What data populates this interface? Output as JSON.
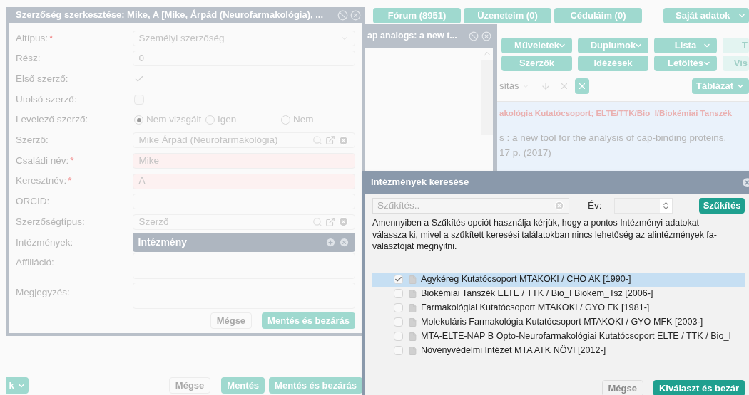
{
  "background_page": {
    "top_nav": [
      {
        "label": "Fórum (8951)",
        "dropdown": false
      },
      {
        "label": "Üzeneteim (0)",
        "dropdown": false
      },
      {
        "label": "Céduláim (0)",
        "dropdown": false
      },
      {
        "label": "Saját adatok",
        "dropdown": true
      }
    ],
    "toolbar_rows": [
      [
        {
          "label": "Műveletek",
          "dropdown": true,
          "disabled": false
        },
        {
          "label": "Duplumok",
          "dropdown": true,
          "disabled": false
        },
        {
          "label": "Lista",
          "dropdown": true,
          "disabled": false
        },
        {
          "label": "T",
          "dropdown": false,
          "disabled": true
        }
      ],
      [
        {
          "label": "Szerzők",
          "dropdown": false,
          "disabled": false
        },
        {
          "label": "Idézések",
          "dropdown": false,
          "disabled": false
        },
        {
          "label": "Letöltés",
          "dropdown": true,
          "disabled": false
        },
        {
          "label": "Vis",
          "dropdown": false,
          "disabled": true
        }
      ]
    ],
    "filter_bar": {
      "sort_select": "sítás",
      "view_button": "Táblázat"
    },
    "record": {
      "institutions": "akológia Kutatócsoport; ELTE/TTK/Bio_I/Biokémiai Tanszék",
      "title": "s : a new tool for the analysis of cap-binding proteins.",
      "source": "17 p. (2017)"
    }
  },
  "background_window": {
    "title": "ap analogs: a new t..."
  },
  "author_dialog": {
    "title": "Szerzőség szerkesztése: Mike, A [Mike, Árpád (Neurofarmakológia), ...",
    "fields": [
      {
        "label": "Altípus:",
        "required_mark": "*",
        "kind": "select",
        "value": "Személyi szerzőség"
      },
      {
        "label": "Rész:",
        "kind": "text",
        "value": "0"
      },
      {
        "label": "Első szerző:",
        "kind": "checkbox",
        "checked": true
      },
      {
        "label": "Utolsó szerző:",
        "kind": "checkbox",
        "checked": false
      },
      {
        "label": "Levelező szerző:",
        "kind": "radio",
        "options": [
          {
            "label": "Nem vizsgált",
            "selected": true
          },
          {
            "label": "Igen",
            "selected": false
          },
          {
            "label": "Nem",
            "selected": false
          }
        ]
      },
      {
        "label": "Szerző:",
        "kind": "lookup",
        "value": "Mike Árpád (Neurofarmakológia)"
      },
      {
        "label": "Családi név:",
        "required_mark": "*",
        "kind": "text",
        "value": "Mike"
      },
      {
        "label": "Keresztnév:",
        "required_mark": "*",
        "kind": "text",
        "value": "A"
      },
      {
        "label": "ORCID:",
        "kind": "text"
      },
      {
        "label": "Szerzőségtípus:",
        "kind": "lookup",
        "value": "Szerző"
      },
      {
        "label": "Intézmények:",
        "kind": "list",
        "value": "Intézmény"
      },
      {
        "label": "Affiliáció:",
        "kind": "textarea"
      },
      {
        "label": "Megjegyzés:",
        "kind": "textarea"
      }
    ],
    "buttons": [
      {
        "label": "Mégse",
        "primary": false
      },
      {
        "label": "Mentés és bezárás",
        "primary": true
      }
    ]
  },
  "outer_footer": {
    "menu_button": "k",
    "buttons": [
      {
        "label": "Mégse",
        "primary": false
      },
      {
        "label": "Mentés",
        "primary": true
      },
      {
        "label": "Mentés és bezárás",
        "primary": true
      }
    ]
  },
  "institution_dialog": {
    "title": "Intézmények keresése",
    "filter_placeholder": "Szűkítés..",
    "year_label": "Év:",
    "filter_button": "Szűkítés",
    "notice": "Amennyiben a Szűkítés opciót használja kérjük, hogy a pontos Intézményi adatokat válassza ki, mivel a szűkített keresési találatokban nincs lehetőség az alintézmények fa-választóját megnyitni.",
    "items": [
      {
        "label": "Agykéreg Kutatócsoport MTAKOKI / CHO AK [1990-]",
        "checked": true,
        "selected": true
      },
      {
        "label": "Biokémiai Tanszék ELTE / TTK / Bio_I Biokem_Tsz [2006-]",
        "checked": false,
        "selected": false
      },
      {
        "label": "Farmakológiai Kutatócsoport MTAKOKI / GYO FK [1981-]",
        "checked": false,
        "selected": false
      },
      {
        "label": "Molekuláris Farmakológia Kutatócsoport MTAKOKI / GYO MFK [2003-]",
        "checked": false,
        "selected": false
      },
      {
        "label": "MTA-ELTE-NAP B Opto-Neurofarmakológiai Kutatócsoport ELTE / TTK / Bio_I",
        "checked": false,
        "selected": false
      },
      {
        "label": "Növényvédelmi Intézet MTA ATK NÖVI [2012-]",
        "checked": false,
        "selected": false
      }
    ],
    "buttons": [
      {
        "label": "Mégse",
        "primary": false
      },
      {
        "label": "Kiválaszt és bezár",
        "primary": true
      }
    ]
  }
}
